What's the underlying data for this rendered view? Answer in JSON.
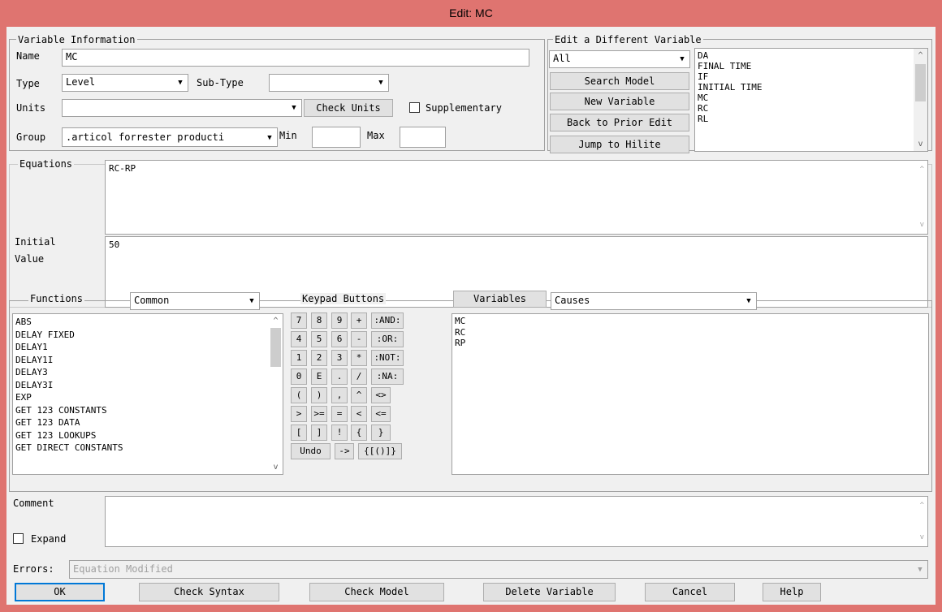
{
  "window": {
    "title": "Edit: MC"
  },
  "variable_info": {
    "legend": "Variable Information",
    "name_label": "Name",
    "name_value": "MC",
    "type_label": "Type",
    "type_value": "Level",
    "subtype_label": "Sub-Type",
    "subtype_value": "",
    "units_label": "Units",
    "units_value": "",
    "check_units_label": "Check Units",
    "supplementary_label": "Supplementary",
    "group_label": "Group",
    "group_value": ".articol forrester producti",
    "min_label": "Min",
    "min_value": "",
    "max_label": "Max",
    "max_value": ""
  },
  "edit_different": {
    "legend": "Edit a Different Variable",
    "filter_value": "All",
    "search_model_label": "Search Model",
    "new_variable_label": "New Variable",
    "back_label": "Back to Prior Edit",
    "jump_label": "Jump to Hilite",
    "variables": [
      "DA",
      "FINAL TIME",
      "IF",
      "INITIAL TIME",
      "MC",
      "RC",
      "RL"
    ]
  },
  "equations": {
    "label": "Equations",
    "value": "RC-RP",
    "initial_label_1": "Initial",
    "initial_label_2": "Value",
    "initial_value": "50"
  },
  "functions": {
    "label": "Functions",
    "category": "Common",
    "items": [
      "ABS",
      "DELAY FIXED",
      "DELAY1",
      "DELAY1I",
      "DELAY3",
      "DELAY3I",
      "EXP",
      "GET 123 CONSTANTS",
      "GET 123 DATA",
      "GET 123 LOOKUPS",
      "GET DIRECT CONSTANTS"
    ]
  },
  "keypad": {
    "label": "Keypad Buttons",
    "row1": [
      "7",
      "8",
      "9",
      "+",
      ":AND:"
    ],
    "row2": [
      "4",
      "5",
      "6",
      "-",
      ":OR:"
    ],
    "row3": [
      "1",
      "2",
      "3",
      "*",
      ":NOT:"
    ],
    "row4": [
      "0",
      "E",
      ".",
      "/",
      ":NA:"
    ],
    "row5": [
      "(",
      ")",
      ",",
      "^",
      "<>"
    ],
    "row6": [
      ">",
      ">=",
      "=",
      "<",
      "<="
    ],
    "row7": [
      "[",
      "]",
      "!",
      "{",
      "}"
    ],
    "row8": [
      "Undo",
      "->",
      "{[()]}"
    ]
  },
  "variables_panel": {
    "button_label": "Variables",
    "filter_value": "Causes",
    "items": [
      "MC",
      "RC",
      "RP"
    ]
  },
  "comment": {
    "label": "Comment",
    "expand_label": "Expand",
    "value": ""
  },
  "errors": {
    "label": "Errors:",
    "value": "Equation Modified"
  },
  "bottom_buttons": {
    "ok": "OK",
    "check_syntax": "Check Syntax",
    "check_model": "Check Model",
    "delete_variable": "Delete Variable",
    "cancel": "Cancel",
    "help": "Help"
  }
}
